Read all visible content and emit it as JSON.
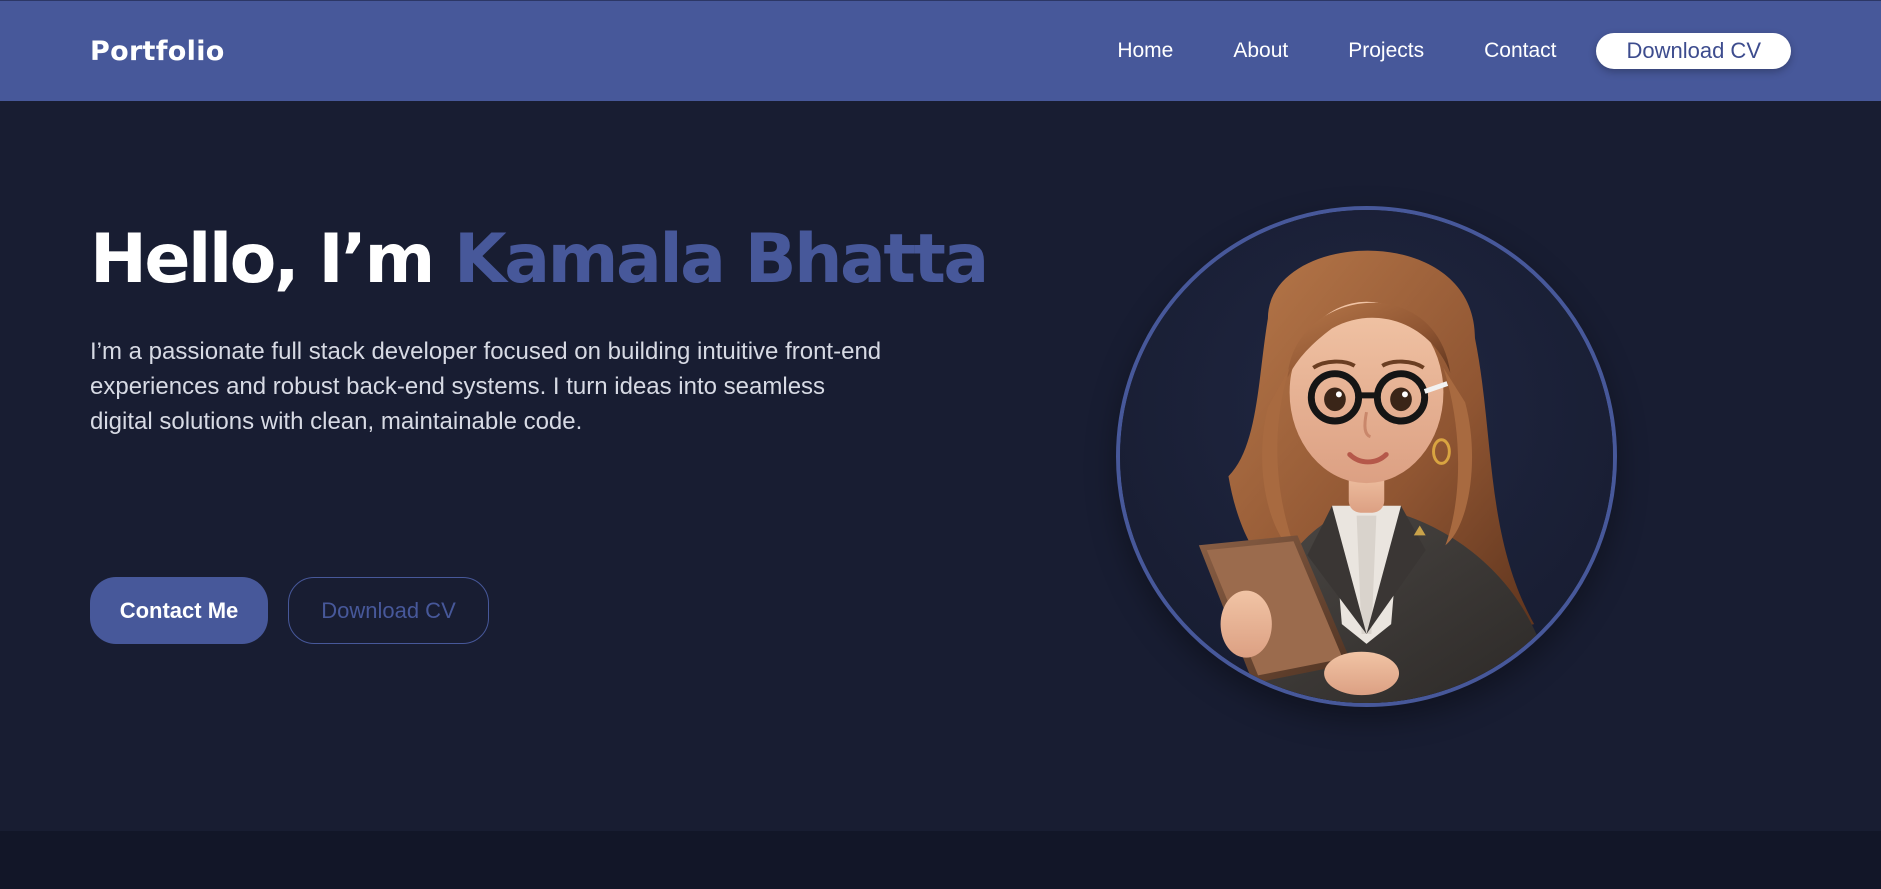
{
  "nav": {
    "brand": "Portfolio",
    "links": [
      {
        "label": "Home"
      },
      {
        "label": "About"
      },
      {
        "label": "Projects"
      },
      {
        "label": "Contact"
      }
    ],
    "cta_label": "Download CV"
  },
  "hero": {
    "greeting": "Hello, I’m",
    "name": "Kamala Bhatta",
    "bio": "I’m a passionate full stack developer focused on building intuitive front-end experiences and robust back-end systems. I turn ideas into seamless digital solutions with clean, maintainable code.",
    "primary_button": "Contact Me",
    "secondary_button": "Download CV",
    "avatar_alt": "3D cartoon avatar of a woman with glasses holding a folder"
  },
  "colors": {
    "accent": "#47589a",
    "background": "#181d32",
    "footer_band": "#121628",
    "text_light": "#ffffff"
  }
}
